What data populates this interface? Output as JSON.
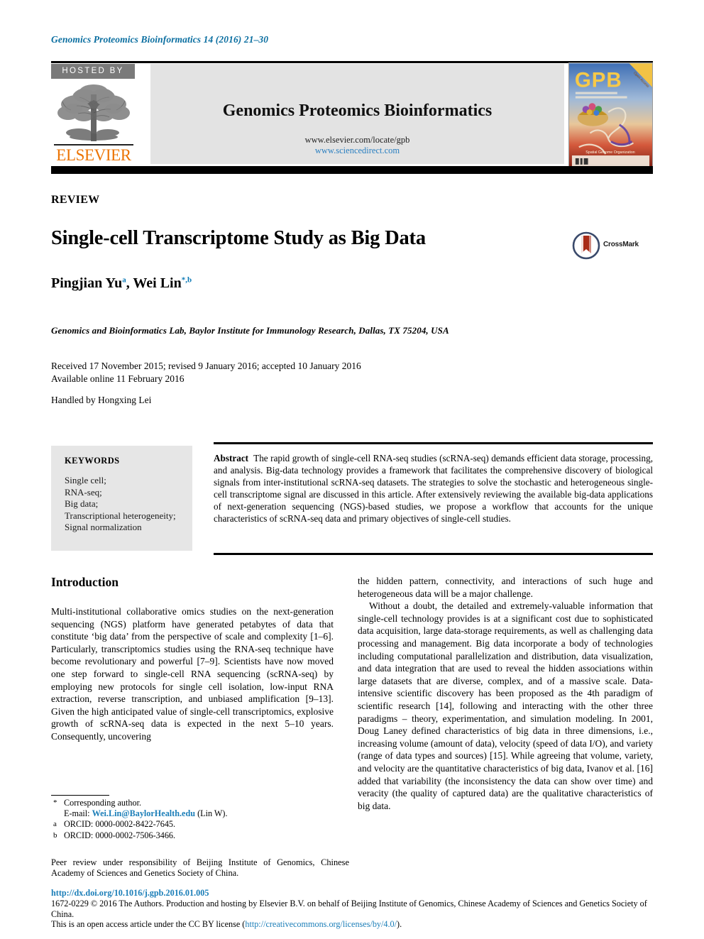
{
  "running_head": "Genomics Proteomics Bioinformatics 14 (2016) 21–30",
  "banner": {
    "hosted_by_label": "HOSTED BY",
    "publisher_name": "ELSEVIER",
    "journal_name": "Genomics Proteomics Bioinformatics",
    "url_locate": "www.elsevier.com/locate/gpb",
    "url_sciencedirect": "www.sciencedirect.com",
    "cover_title": "GPB",
    "cover_subtitle": "Genomics Proteomics Bioinformatics",
    "cover_corner": "Open Access",
    "cover_caption": "Spatial Genome Organization"
  },
  "article": {
    "type_label": "REVIEW",
    "title": "Single-cell Transcriptome Study as Big Data",
    "crossmark_label": "CrossMark",
    "authors": "Pingjian Yu",
    "author_1_marks": "a",
    "authors_2": ", Wei Lin",
    "author_2_marks": "*,b",
    "affiliation": "Genomics and Bioinformatics Lab, Baylor Institute for Immunology Research, Dallas, TX 75204, USA",
    "dates_line1": "Received 17 November 2015; revised 9 January 2016; accepted 10 January 2016",
    "dates_line2": "Available online 11 February 2016",
    "handled_by": "Handled by Hongxing Lei"
  },
  "keywords": {
    "heading": "KEYWORDS",
    "items": "Single cell;\nRNA-seq;\nBig data;\nTranscriptional heterogeneity;\nSignal normalization"
  },
  "abstract": {
    "label": "Abstract",
    "text": "The rapid growth of single-cell RNA-seq studies (scRNA-seq) demands efficient data storage, processing, and analysis. Big-data technology provides a framework that facilitates the comprehensive discovery of biological signals from inter-institutional scRNA-seq datasets. The strategies to solve the stochastic and heterogeneous single-cell transcriptome signal are discussed in this article. After extensively reviewing the available big-data applications of next-generation sequencing (NGS)-based studies, we propose a workflow that accounts for the unique characteristics of scRNA-seq data and primary objectives of single-cell studies."
  },
  "body": {
    "section_title": "Introduction",
    "left_paragraph_1": "Multi-institutional collaborative omics studies on the next-generation sequencing (NGS) platform have generated petabytes of data that constitute ‘big data’ from the perspective of scale and complexity [1–6]. Particularly, transcriptomics studies using the RNA-seq technique have become revolutionary and powerful [7–9]. Scientists have now moved one step forward to single-cell RNA sequencing (scRNA-seq) by employing new protocols for single cell isolation, low-input RNA extraction, reverse transcription, and unbiased amplification [9–13]. Given the high anticipated value of single-cell transcriptomics, explosive growth of scRNA-seq data is expected in the next 5–10 years. Consequently, uncovering",
    "right_paragraph_1": "the hidden pattern, connectivity, and interactions of such huge and heterogeneous data will be a major challenge.",
    "right_paragraph_2": "Without a doubt, the detailed and extremely-valuable information that single-cell technology provides is at a significant cost due to sophisticated data acquisition, large data-storage requirements, as well as challenging data processing and management. Big data incorporate a body of technologies including computational parallelization and distribution, data visualization, and data integration that are used to reveal the hidden associations within large datasets that are diverse, complex, and of a massive scale. Data-intensive scientific discovery has been proposed as the 4th paradigm of scientific research [14], following and interacting with the other three paradigms – theory, experimentation, and simulation modeling. In 2001, Doug Laney defined characteristics of big data in three dimensions, i.e., increasing volume (amount of data), velocity (speed of data I/O), and variety (range of data types and sources) [15]. While agreeing that volume, variety, and velocity are the quantitative characteristics of big data, Ivanov et al. [16] added that variability (the inconsistency the data can show over time) and veracity (the quality of captured data) are the qualitative characteristics of big data."
  },
  "footnotes": {
    "corresponding_mark": "*",
    "corresponding_text": "Corresponding author.",
    "email_prefix": "E-mail:",
    "email": "Wei.Lin@BaylorHealth.edu",
    "email_suffix": "(Lin W).",
    "orcid_a_mark": "a",
    "orcid_a": "ORCID: 0000-0002-8422-7645.",
    "orcid_b_mark": "b",
    "orcid_b": "ORCID: 0000-0002-7506-3466.",
    "peer_review": "Peer review under responsibility of Beijing Institute of Genomics, Chinese Academy of Sciences and Genetics Society of China."
  },
  "footer": {
    "doi": "http://dx.doi.org/10.1016/j.gpb.2016.01.005",
    "copyright": "1672-0229 © 2016 The Authors. Production and hosting by Elsevier B.V. on behalf of Beijing Institute of Genomics, Chinese Academy of Sciences and Genetics Society of China.",
    "license_prefix": "This is an open access article under the CC BY license (",
    "license_url": "http://creativecommons.org/licenses/by/4.0/",
    "license_suffix": ")."
  },
  "colors": {
    "link_blue": "#1b7eb8",
    "running_head_blue": "#0a6ea0",
    "elsevier_orange": "#ec7404",
    "band_gray": "#e3e3e3",
    "keyword_gray": "#e6e6e6",
    "hosted_gray": "#7a7a7a"
  }
}
